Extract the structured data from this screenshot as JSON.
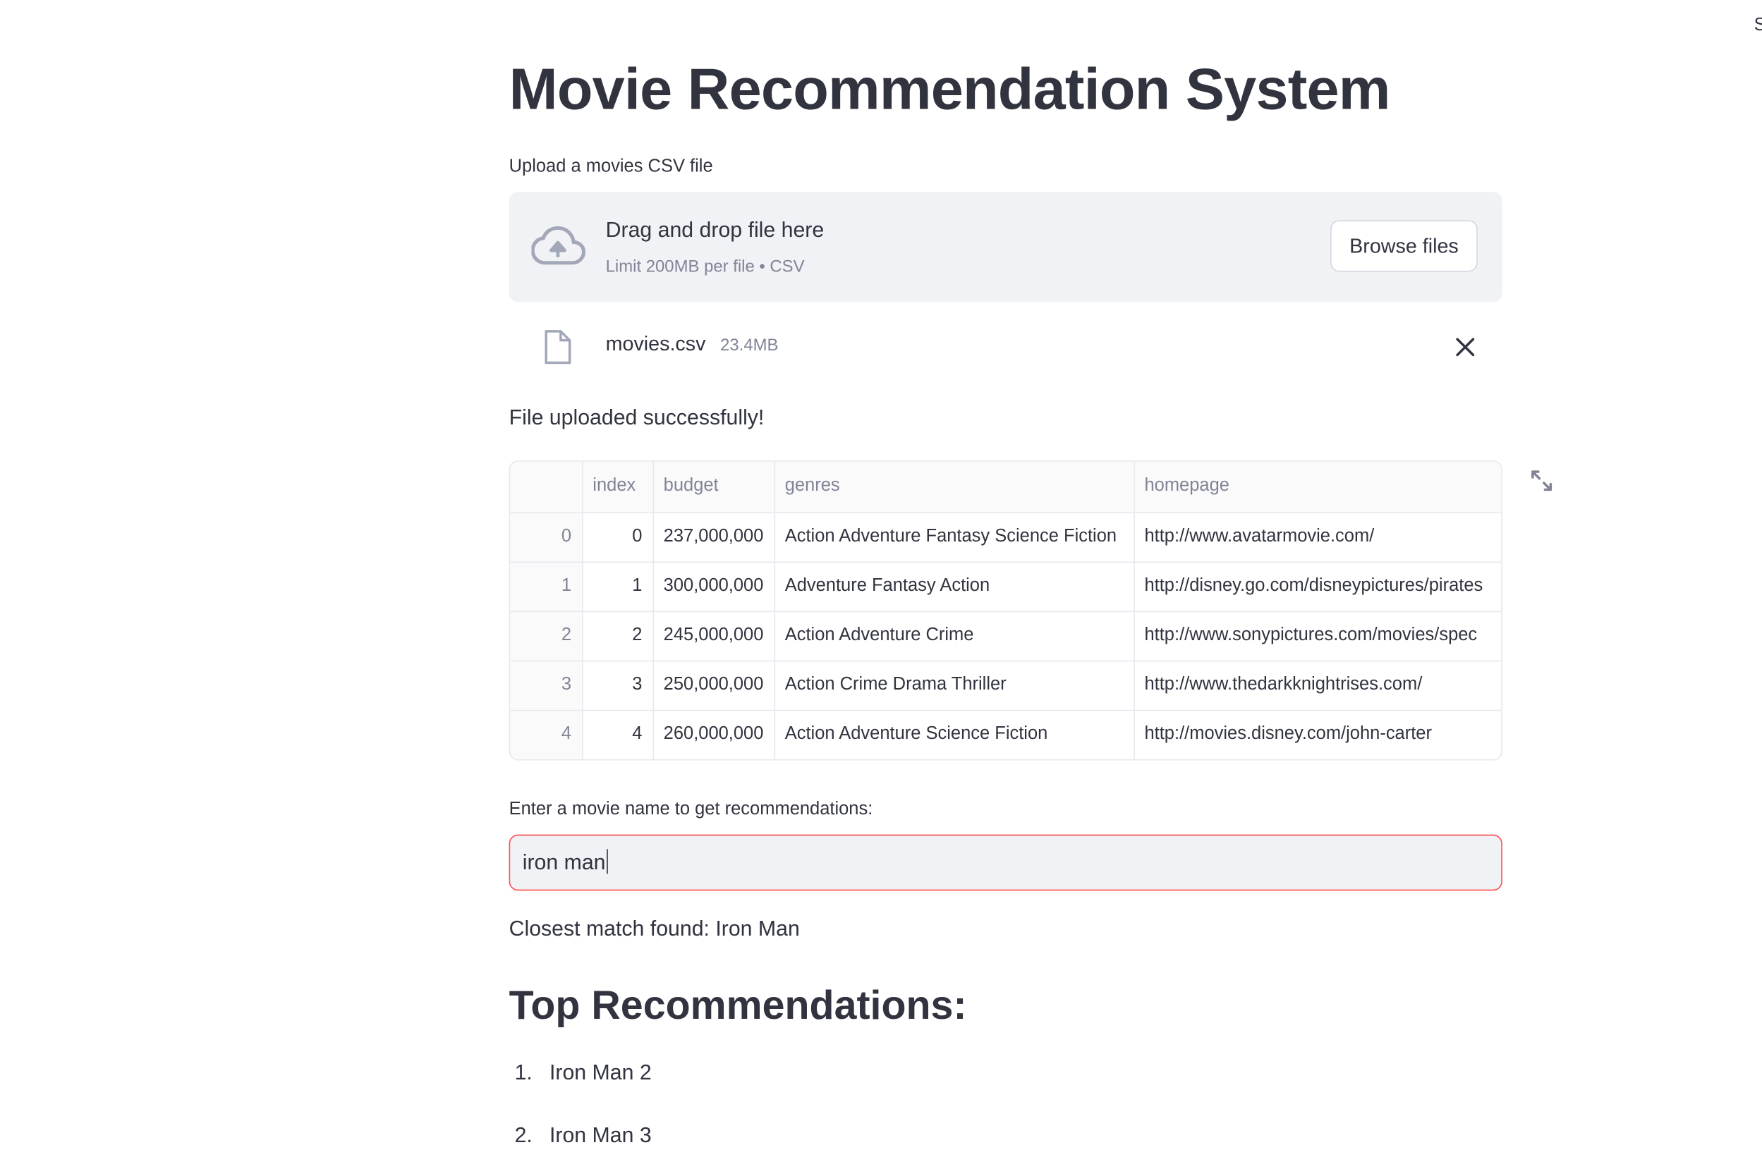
{
  "corner_text": "S",
  "title": "Movie Recommendation System",
  "uploader": {
    "label": "Upload a movies CSV file",
    "drag_text": "Drag and drop file here",
    "limit_text": "Limit 200MB per file • CSV",
    "browse_label": "Browse files",
    "icon": "cloud-upload-icon"
  },
  "file": {
    "name": "movies.csv",
    "size": "23.4MB",
    "icon": "file-icon"
  },
  "success_message": "File uploaded successfully!",
  "table": {
    "columns": [
      "",
      "index",
      "budget",
      "genres",
      "homepage"
    ],
    "rows": [
      [
        "0",
        "0",
        "237,000,000",
        "Action Adventure Fantasy Science Fiction",
        "http://www.avatarmovie.com/"
      ],
      [
        "1",
        "1",
        "300,000,000",
        "Adventure Fantasy Action",
        "http://disney.go.com/disneypictures/pirates"
      ],
      [
        "2",
        "2",
        "245,000,000",
        "Action Adventure Crime",
        "http://www.sonypictures.com/movies/spec"
      ],
      [
        "3",
        "3",
        "250,000,000",
        "Action Crime Drama Thriller",
        "http://www.thedarkknightrises.com/"
      ],
      [
        "4",
        "4",
        "260,000,000",
        "Action Adventure Science Fiction",
        "http://movies.disney.com/john-carter"
      ]
    ]
  },
  "search": {
    "label": "Enter a movie name to get recommendations:",
    "value": "iron man"
  },
  "match_text": "Closest match found: Iron Man",
  "recommendations_heading": "Top Recommendations:",
  "recommendations": [
    {
      "num": "1.",
      "title": "Iron Man 2"
    },
    {
      "num": "2.",
      "title": "Iron Man 3"
    }
  ],
  "colors": {
    "text": "#31333f",
    "muted": "#808495",
    "panel": "#f0f2f6",
    "focus_border": "#ff4b4b"
  }
}
